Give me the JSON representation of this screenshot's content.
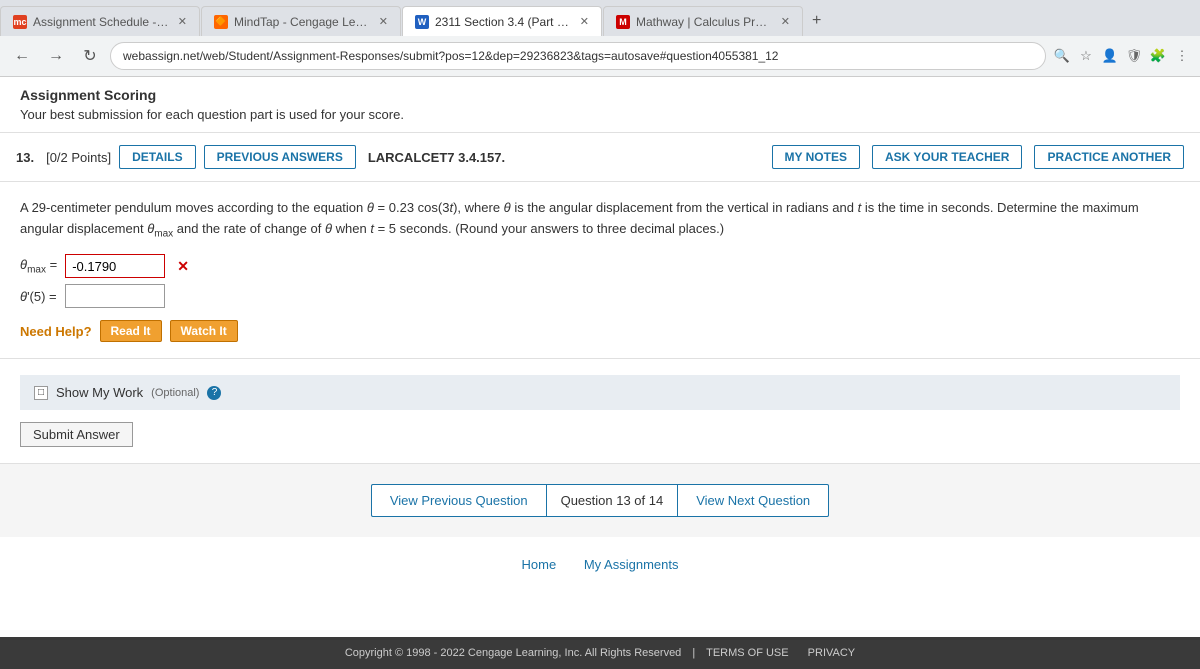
{
  "browser": {
    "tabs": [
      {
        "id": 1,
        "label": "Assignment Schedule - MAC231",
        "icon_color": "#e04020",
        "icon_text": "mc",
        "active": false
      },
      {
        "id": 2,
        "label": "MindTap - Cengage Learning",
        "icon_color": "#e05020",
        "icon_text": "🔶",
        "active": false
      },
      {
        "id": 3,
        "label": "2311 Section 3.4 (Part I) - MAC 2",
        "icon_color": "#2060c0",
        "icon_text": "W",
        "active": true
      },
      {
        "id": 4,
        "label": "Mathway | Calculus Problem Sol...",
        "icon_color": "#cc0000",
        "icon_text": "M",
        "active": false
      }
    ],
    "url": "webassign.net/web/Student/Assignment-Responses/submit?pos=12&dep=29236823&tags=autosave#question4055381_12",
    "new_tab": "+"
  },
  "assignment_scoring": {
    "title": "Assignment Scoring",
    "description": "Your best submission for each question part is used for your score."
  },
  "question": {
    "number": "13.",
    "points": "[0/2 Points]",
    "buttons": {
      "details": "DETAILS",
      "previous_answers": "PREVIOUS ANSWERS",
      "label": "LARCALCET7 3.4.157.",
      "my_notes": "MY NOTES",
      "ask_teacher": "ASK YOUR TEACHER",
      "practice_another": "PRACTICE ANOTHER"
    },
    "text_part1": "A 29-centimeter pendulum moves according to the equation ",
    "equation": "θ = 0.23 cos(3t)",
    "text_part2": ", where ",
    "theta_desc": "θ",
    "text_part3": " is the angular displacement from the vertical in radians and ",
    "t_desc": "t",
    "text_part4": " is the time in seconds. Determine the maximum angular displacement ",
    "theta_max": "θ",
    "text_part5": " and the rate of change of ",
    "theta_word": "θ",
    "text_part6": " when ",
    "t_val": "t",
    "text_part7": " = 5 seconds. (Round your answers to three decimal places.)",
    "full_text": "A 29-centimeter pendulum moves according to the equation θ = 0.23 cos(3t), where θ is the angular displacement from the vertical in radians and t is the time in seconds. Determine the maximum angular displacement θmax and the rate of change of θ when t = 5 seconds. (Round your answers to three decimal places.)",
    "theta_max_label": "θmax =",
    "theta_max_value": "-0.1790",
    "theta_prime_label": "θ'(5) =",
    "theta_prime_value": "",
    "error_mark": "✕",
    "need_help": {
      "label": "Need Help?",
      "read_it": "Read It",
      "watch_it": "Watch It"
    },
    "show_my_work": {
      "label": "Show My Work",
      "optional": "(Optional)",
      "info": "?"
    },
    "submit_label": "Submit Answer"
  },
  "navigation": {
    "prev_label": "View Previous Question",
    "middle_label": "Question 13 of 14",
    "next_label": "View Next Question"
  },
  "footer": {
    "home": "Home",
    "my_assignments": "My Assignments"
  },
  "bottom_bar": {
    "copyright": "Copyright © 1998 - 2022 Cengage Learning, Inc. All Rights Reserved",
    "terms": "TERMS OF USE",
    "privacy": "PRIVACY"
  }
}
